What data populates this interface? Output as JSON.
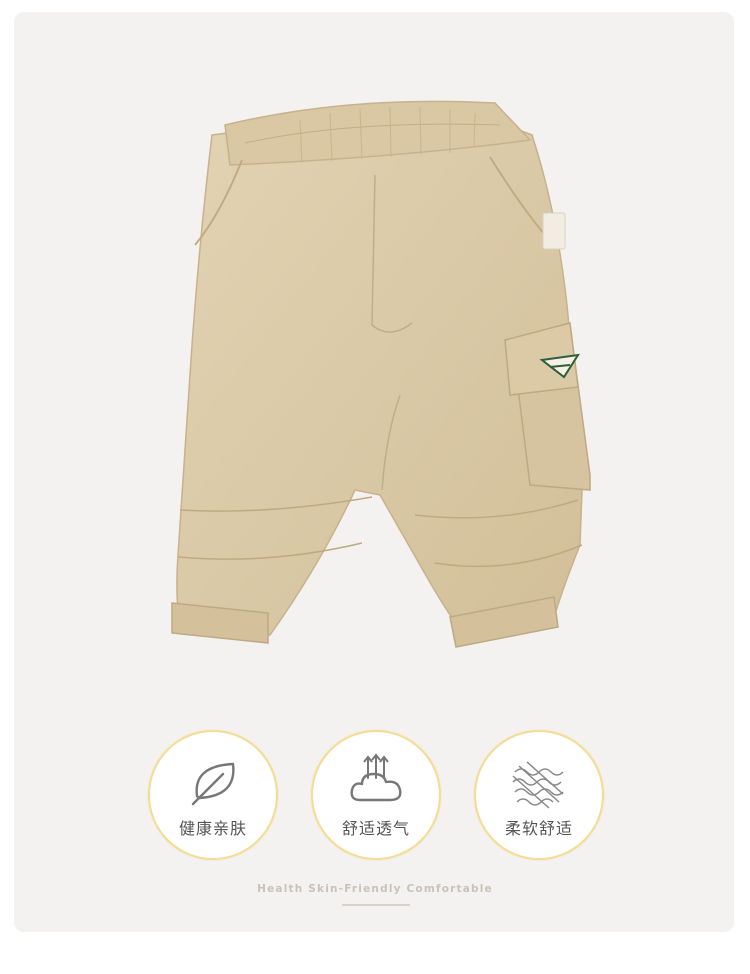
{
  "product": {
    "image_alt": "Khaki children's cropped cargo pants",
    "colors": {
      "fabric": "#dccba8",
      "shadow": "#c8b48e",
      "patch": "#2f5e3a"
    }
  },
  "features": [
    {
      "icon": "leaf-icon",
      "label": "健康亲肤"
    },
    {
      "icon": "breathable-cloud-icon",
      "label": "舒适透气"
    },
    {
      "icon": "soft-fabric-icon",
      "label": "柔软舒适"
    }
  ],
  "tagline": "Health  Skin-Friendly Comfortable",
  "accent_color": "#f4dc94"
}
